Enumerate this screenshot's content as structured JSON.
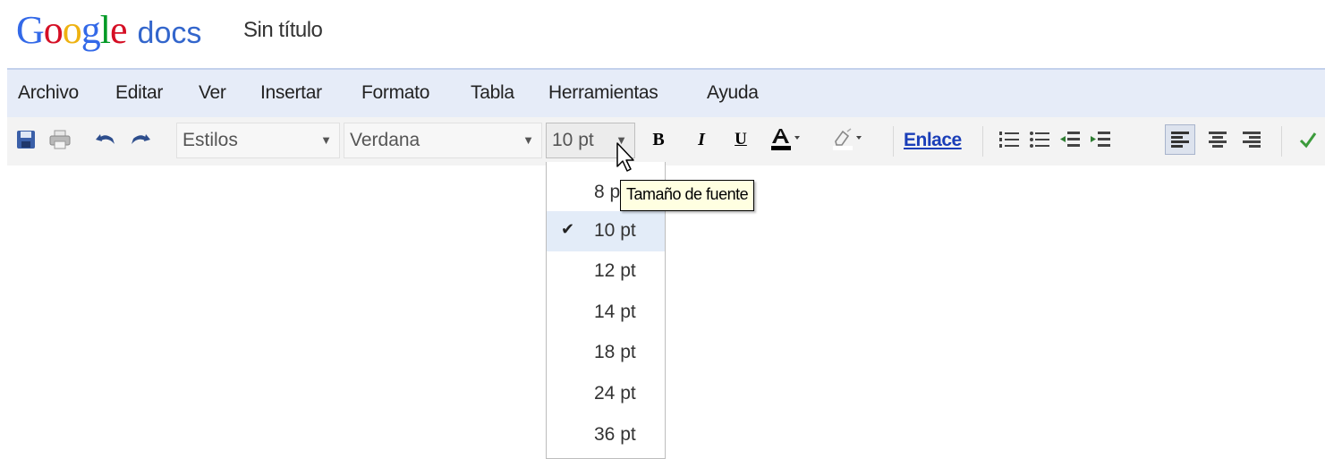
{
  "app": {
    "logo_letters": [
      "G",
      "o",
      "o",
      "g",
      "l",
      "e"
    ],
    "logo_colors": [
      "#3369e8",
      "#d50f25",
      "#eeb211",
      "#3369e8",
      "#009925",
      "#d50f25"
    ],
    "product": "docs",
    "document_title": "Sin título"
  },
  "menubar": {
    "items": [
      "Archivo",
      "Editar",
      "Ver",
      "Insertar",
      "Formato",
      "Tabla",
      "Herramientas",
      "Ayuda"
    ]
  },
  "toolbar": {
    "styles_label": "Estilos",
    "font_label": "Verdana",
    "size_label": "10 pt",
    "link_label": "Enlace",
    "icons": [
      "save-icon",
      "print-icon",
      "undo-icon",
      "redo-icon",
      "bold-icon",
      "italic-icon",
      "underline-icon",
      "text-color-icon",
      "highlight-color-icon",
      "numbered-list-icon",
      "bulleted-list-icon",
      "decrease-indent-icon",
      "increase-indent-icon",
      "align-left-icon",
      "align-center-icon",
      "align-right-icon",
      "spellcheck-icon"
    ]
  },
  "font_size_menu": {
    "items": [
      "8 pt",
      "10 pt",
      "12 pt",
      "14 pt",
      "18 pt",
      "24 pt",
      "36 pt"
    ],
    "selected": "10 pt",
    "checkmark": "✔"
  },
  "tooltip": {
    "text": "Tamaño de fuente"
  },
  "colors": {
    "menubar_bg": "#e6ecf8",
    "toolbar_bg": "#f3f3f3",
    "link_blue": "#1a3eb8",
    "selected_item_bg": "#e3ecf8",
    "tooltip_bg": "#ffffe1"
  }
}
